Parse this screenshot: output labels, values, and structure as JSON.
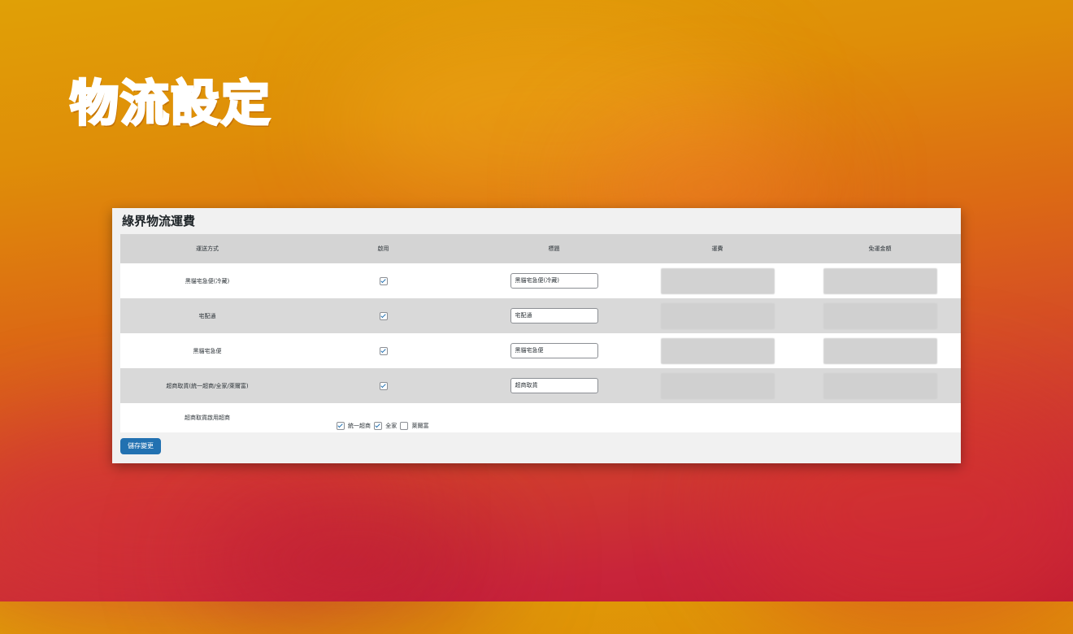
{
  "slide": {
    "title": "物流設定"
  },
  "panel": {
    "title": "綠界物流運費",
    "columns": [
      "運送方式",
      "啟用",
      "標題",
      "運費",
      "免運金額"
    ],
    "rows": [
      {
        "method": "黑貓宅急便(冷藏)",
        "enabled": true,
        "title_value": "黑貓宅急便(冷藏)"
      },
      {
        "method": "宅配通",
        "enabled": true,
        "title_value": "宅配通"
      },
      {
        "method": "黑貓宅急便",
        "enabled": true,
        "title_value": "黑貓宅急便"
      },
      {
        "method": "超商取貨(統一超商/全家/萊爾富)",
        "enabled": true,
        "title_value": "超商取貨"
      }
    ],
    "store_row": {
      "label": "超商取貨啟用超商",
      "options": [
        {
          "label": "統一超商",
          "checked": true
        },
        {
          "label": "全家",
          "checked": true
        },
        {
          "label": "萊爾富",
          "checked": false
        }
      ]
    },
    "save_label": "儲存變更"
  }
}
